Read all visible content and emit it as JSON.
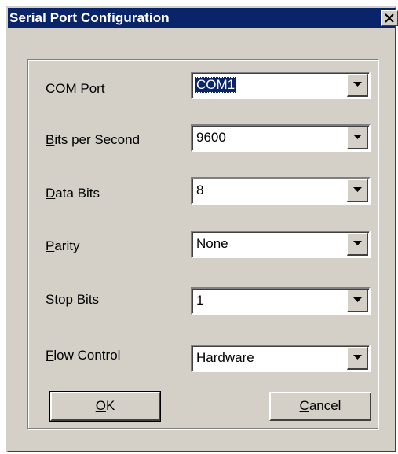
{
  "window": {
    "title": "Serial Port Configuration",
    "close_symbol": "×"
  },
  "fields": [
    {
      "label": "COM Port",
      "accesskey": "C",
      "value": "COM1",
      "focused": true
    },
    {
      "label": "Bits per Second",
      "accesskey": "B",
      "value": "9600",
      "focused": false
    },
    {
      "label": "Data Bits",
      "accesskey": "D",
      "value": "8",
      "focused": false
    },
    {
      "label": "Parity",
      "accesskey": "P",
      "value": "None",
      "focused": false
    },
    {
      "label": "Stop Bits",
      "accesskey": "S",
      "value": "1",
      "focused": false
    },
    {
      "label": "Flow Control",
      "accesskey": "F",
      "value": "Hardware",
      "focused": false
    }
  ],
  "buttons": {
    "ok_label": "OK",
    "ok_accesskey": "O",
    "cancel_label": "Cancel",
    "cancel_accesskey": "C"
  },
  "icons": {
    "close": "close-icon",
    "dropdown": "chevron-down-icon"
  },
  "colors": {
    "titlebar": "#0a246a",
    "face": "#d4d0c8",
    "selection": "#0a246a"
  }
}
